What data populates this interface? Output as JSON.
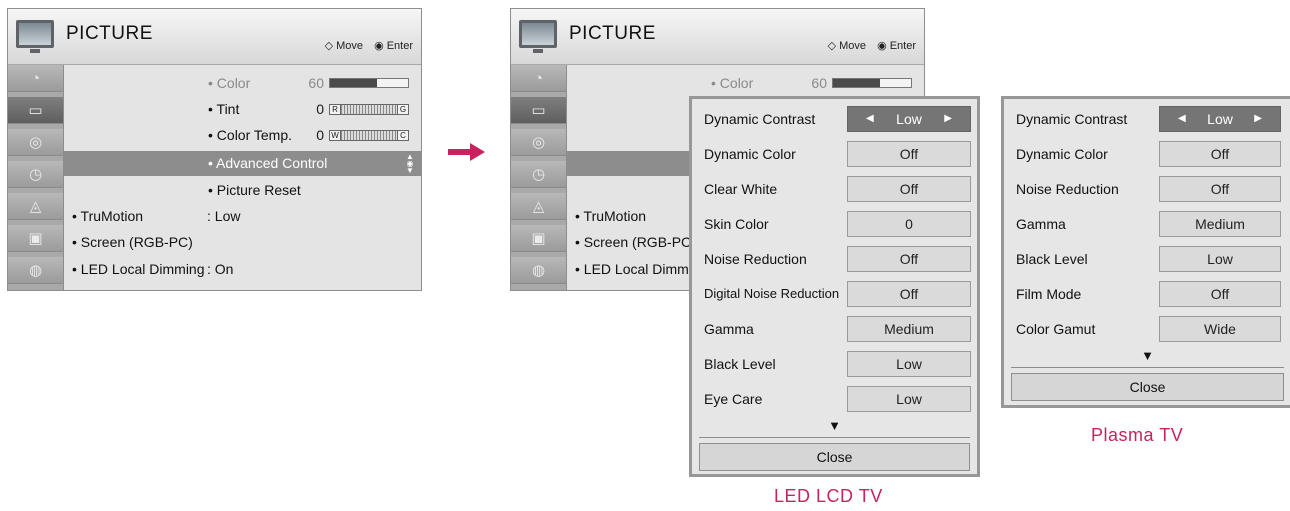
{
  "colors": {
    "accent": "#c8235f",
    "highlight": "#8d8d8d",
    "active_button": "#757575"
  },
  "left_menu": {
    "title": "PICTURE",
    "hint_move": "Move",
    "hint_enter": "Enter",
    "sidebar_icons": [
      "satellite-dish-icon",
      "picture-icon",
      "speaker-icon",
      "clock-icon",
      "lock-icon",
      "option-icon",
      "network-icon"
    ],
    "items": {
      "color_label": "• Color",
      "color_value": "60",
      "color_level": 0.6,
      "tint_label": "• Tint",
      "tint_value": "0",
      "tint_left": "R",
      "tint_right": "G",
      "color_temp_label": "• Color Temp.",
      "color_temp_value": "0",
      "color_temp_left": "W",
      "color_temp_right": "C",
      "advanced_control": "• Advanced Control",
      "picture_reset": "• Picture Reset",
      "trumotion_label": "• TruMotion",
      "trumotion_value": ": Low",
      "screen": "• Screen (RGB-PC)",
      "led_dimming_label": "• LED Local Dimming",
      "led_dimming_value": ": On"
    }
  },
  "right_menu": {
    "title": "PICTURE",
    "hint_move": "Move",
    "hint_enter": "Enter",
    "items": {
      "color_label": "• Color",
      "color_value": "60",
      "color_level": 0.6,
      "trumotion_label": "• TruMotion",
      "screen": "• Screen (RGB-PC",
      "led_dimming_label": "• LED Local Dimm"
    }
  },
  "led_panel": {
    "caption": "LED LCD TV",
    "options": [
      {
        "label": "Dynamic Contrast",
        "value": "Low"
      },
      {
        "label": "Dynamic Color",
        "value": "Off"
      },
      {
        "label": "Clear White",
        "value": "Off"
      },
      {
        "label": "Skin Color",
        "value": "0"
      },
      {
        "label": "Noise Reduction",
        "value": "Off"
      },
      {
        "label": "Digital Noise Reduction",
        "value": "Off"
      },
      {
        "label": "Gamma",
        "value": "Medium"
      },
      {
        "label": "Black Level",
        "value": "Low"
      },
      {
        "label": "Eye Care",
        "value": "Low"
      }
    ],
    "more": "▼",
    "close": "Close"
  },
  "plasma_panel": {
    "caption": "Plasma TV",
    "options": [
      {
        "label": "Dynamic Contrast",
        "value": "Low"
      },
      {
        "label": "Dynamic Color",
        "value": "Off"
      },
      {
        "label": "Noise Reduction",
        "value": "Off"
      },
      {
        "label": "Gamma",
        "value": "Medium"
      },
      {
        "label": "Black Level",
        "value": "Low"
      },
      {
        "label": "Film Mode",
        "value": "Off"
      },
      {
        "label": "Color Gamut",
        "value": "Wide"
      }
    ],
    "more": "▼",
    "close": "Close"
  }
}
